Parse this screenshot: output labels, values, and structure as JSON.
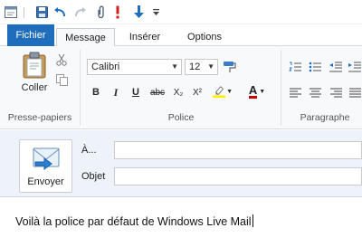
{
  "qat": {
    "icons": [
      "app-icon",
      "save-icon",
      "undo-icon",
      "redo-icon",
      "attach-icon",
      "priority-high-icon",
      "move-down-icon",
      "customize-icon"
    ]
  },
  "tabs": {
    "file": "Fichier",
    "message": "Message",
    "insert": "Insérer",
    "options": "Options"
  },
  "ribbon": {
    "clipboard": {
      "paste_label": "Coller",
      "group_label": "Presse-papiers"
    },
    "font": {
      "font_name": "Calibri",
      "font_size": "12",
      "bold": "B",
      "italic": "I",
      "underline": "U",
      "strike": "abc",
      "subscript": "X₂",
      "superscript": "X²",
      "font_color_letter": "A",
      "group_label": "Police"
    },
    "paragraph": {
      "group_label": "Paragraphe"
    }
  },
  "compose": {
    "send_label": "Envoyer",
    "to_label": "À...",
    "subject_label": "Objet",
    "to_value": "",
    "subject_value": ""
  },
  "body": {
    "text": "Voilà la police par défaut de Windows Live Mail"
  },
  "colors": {
    "file_tab": "#1f6ebe",
    "highlight": "#ffef00",
    "font_color": "#c00000",
    "accent_blue": "#1f6ebe"
  }
}
